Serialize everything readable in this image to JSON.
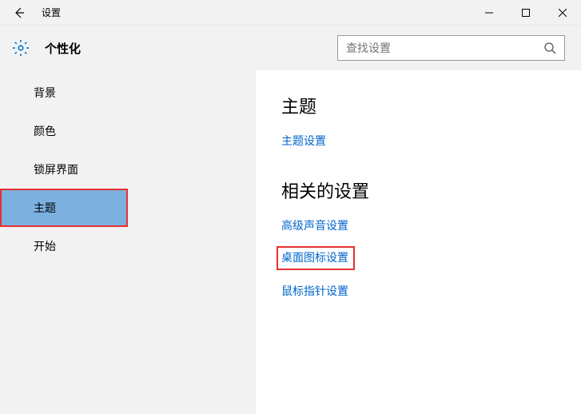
{
  "titlebar": {
    "title": "设置"
  },
  "header": {
    "title": "个性化",
    "search_placeholder": "查找设置"
  },
  "sidebar": {
    "items": [
      {
        "label": "背景"
      },
      {
        "label": "颜色"
      },
      {
        "label": "锁屏界面"
      },
      {
        "label": "主题"
      },
      {
        "label": "开始"
      }
    ]
  },
  "content": {
    "section1_title": "主题",
    "link_theme_settings": "主题设置",
    "section2_title": "相关的设置",
    "link_advanced_sound": "高级声音设置",
    "link_desktop_icons": "桌面图标设置",
    "link_mouse_pointer": "鼠标指针设置"
  }
}
